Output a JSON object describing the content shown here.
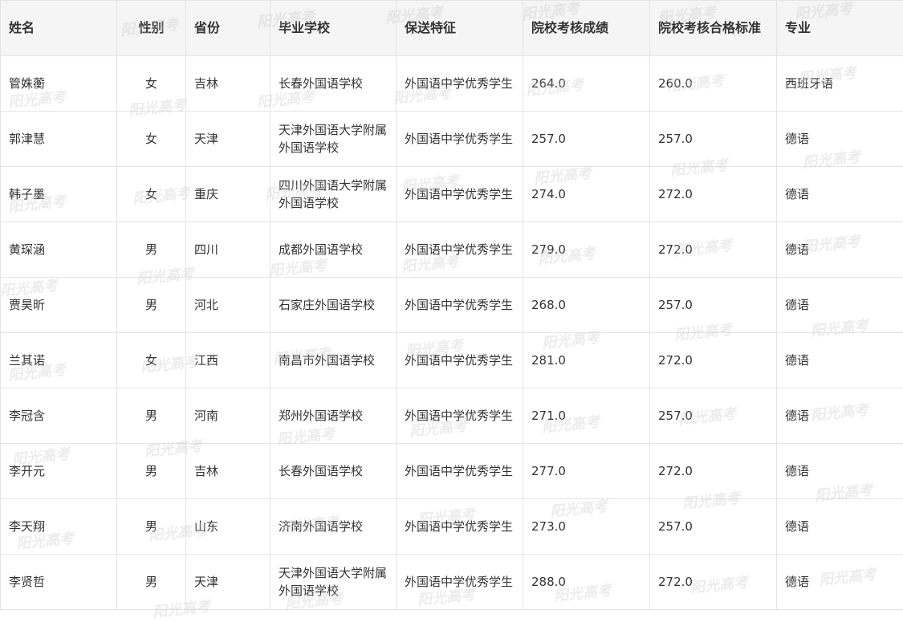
{
  "watermark": "阳光高考",
  "table": {
    "headers": [
      "姓名",
      "性别",
      "省份",
      "毕业学校",
      "保送特征",
      "院校考核成绩",
      "院校考核合格标准",
      "专业"
    ],
    "rows": [
      [
        "管姝蘅",
        "女",
        "吉林",
        "长春外国语学校",
        "外国语中学优秀学生",
        "264.0",
        "260.0",
        "西班牙语"
      ],
      [
        "郭津慧",
        "女",
        "天津",
        "天津外国语大学附属外国语学校",
        "外国语中学优秀学生",
        "257.0",
        "257.0",
        "德语"
      ],
      [
        "韩子墨",
        "女",
        "重庆",
        "四川外国语大学附属外国语学校",
        "外国语中学优秀学生",
        "274.0",
        "272.0",
        "德语"
      ],
      [
        "黄琛涵",
        "男",
        "四川",
        "成都外国语学校",
        "外国语中学优秀学生",
        "279.0",
        "272.0",
        "德语"
      ],
      [
        "贾昊昕",
        "男",
        "河北",
        "石家庄外国语学校",
        "外国语中学优秀学生",
        "268.0",
        "257.0",
        "德语"
      ],
      [
        "兰其诺",
        "女",
        "江西",
        "南昌市外国语学校",
        "外国语中学优秀学生",
        "281.0",
        "272.0",
        "德语"
      ],
      [
        "李冠含",
        "男",
        "河南",
        "郑州外国语学校",
        "外国语中学优秀学生",
        "271.0",
        "257.0",
        "德语"
      ],
      [
        "李开元",
        "男",
        "吉林",
        "长春外国语学校",
        "外国语中学优秀学生",
        "277.0",
        "272.0",
        "德语"
      ],
      [
        "李天翔",
        "男",
        "山东",
        "济南外国语学校",
        "外国语中学优秀学生",
        "273.0",
        "257.0",
        "德语"
      ],
      [
        "李贤哲",
        "男",
        "天津",
        "天津外国语大学附属外国语学校",
        "外国语中学优秀学生",
        "288.0",
        "272.0",
        "德语"
      ]
    ]
  }
}
